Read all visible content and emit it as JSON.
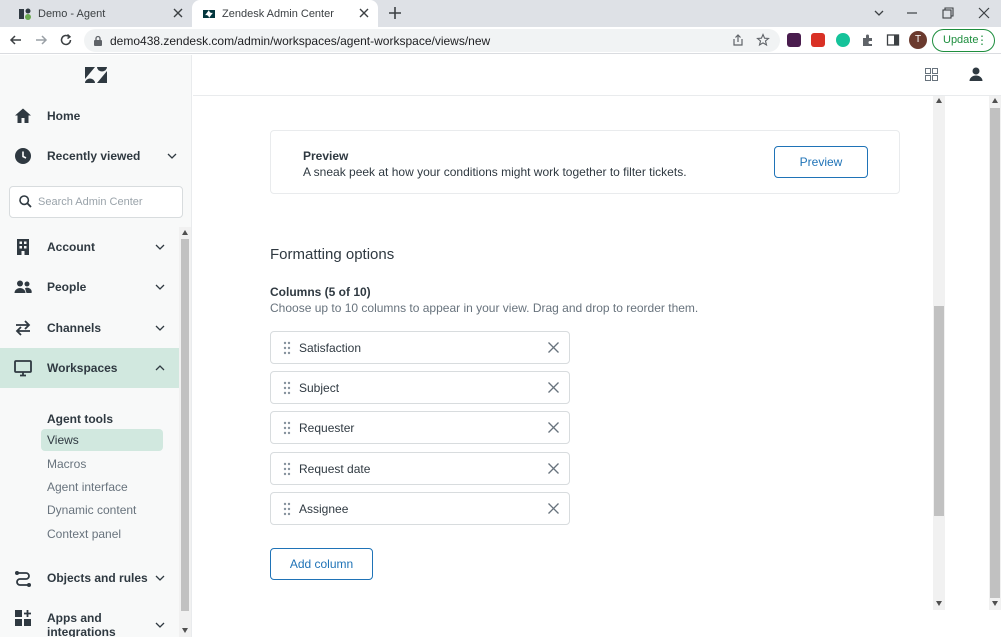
{
  "browser": {
    "tabs": [
      {
        "title": "Demo - Agent",
        "active": false
      },
      {
        "title": "Zendesk Admin Center",
        "active": true
      }
    ],
    "url": "demo438.zendesk.com/admin/workspaces/agent-workspace/views/new",
    "profile_initial": "T",
    "update_label": "Update"
  },
  "sidebar": {
    "search_placeholder": "Search Admin Center",
    "home": "Home",
    "recently_viewed": "Recently viewed",
    "account": "Account",
    "people": "People",
    "channels": "Channels",
    "workspaces": "Workspaces",
    "agent_tools_heading": "Agent tools",
    "sub_items": [
      "Views",
      "Macros",
      "Agent interface",
      "Dynamic content",
      "Context panel"
    ],
    "objects_and_rules": "Objects and rules",
    "apps_line1": "Apps and",
    "apps_line2": "integrations"
  },
  "preview": {
    "title": "Preview",
    "description": "A sneak peek at how your conditions might work together to filter tickets.",
    "button": "Preview"
  },
  "formatting": {
    "heading": "Formatting options",
    "columns_title": "Columns (5 of 10)",
    "columns_desc": "Choose up to 10 columns to appear in your view. Drag and drop to reorder them.",
    "columns": [
      "Satisfaction",
      "Subject",
      "Requester",
      "Request date",
      "Assignee"
    ],
    "add_column": "Add column"
  },
  "colors": {
    "accent": "#1f73b7",
    "active_nav": "#d1e8df",
    "sidebar_bg": "#f8f9f9"
  }
}
